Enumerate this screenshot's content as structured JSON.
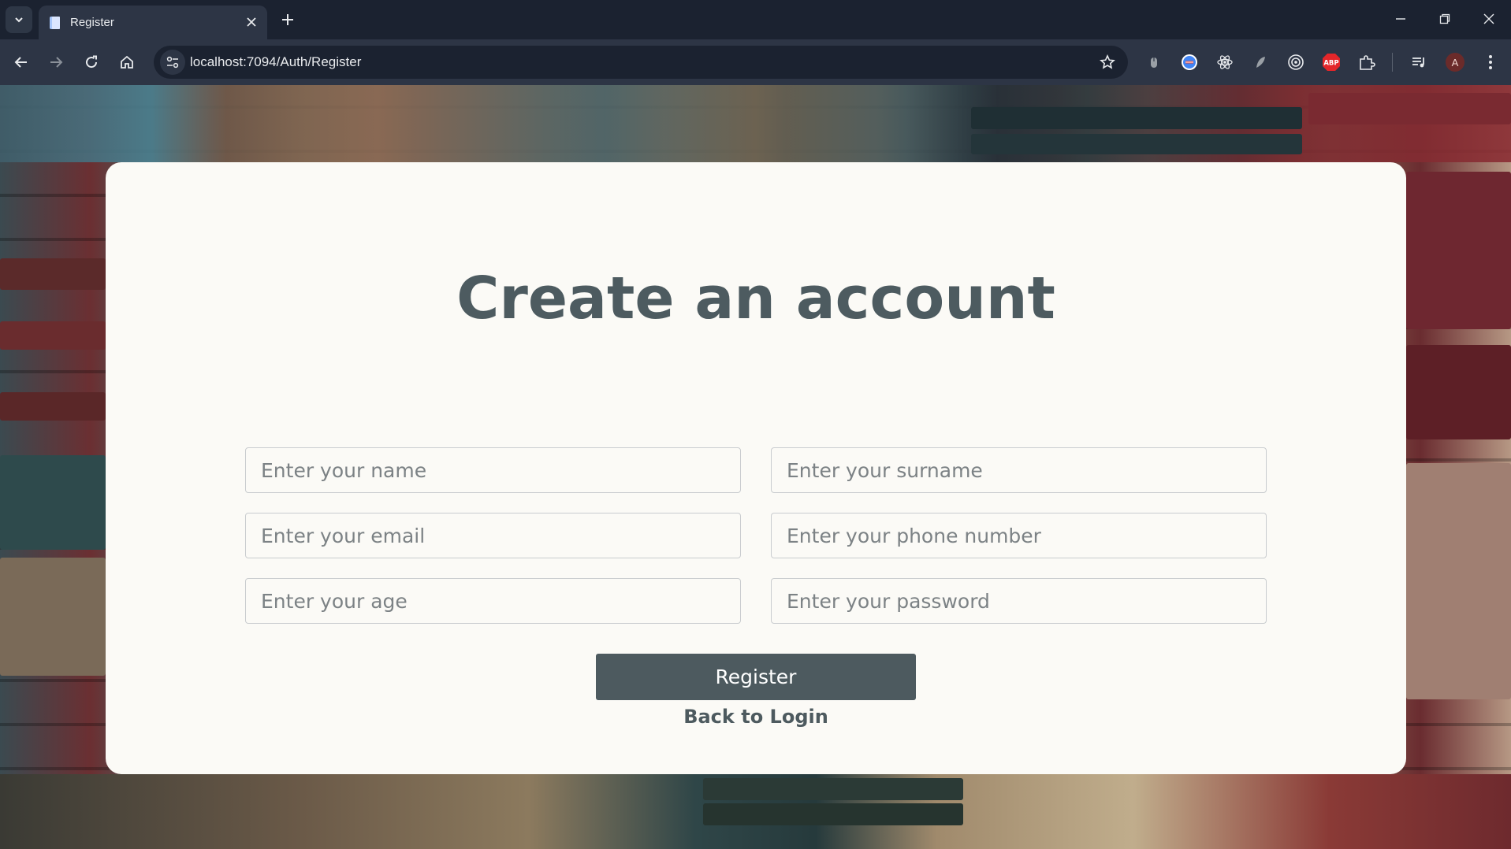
{
  "browser": {
    "tab_title": "Register",
    "url": "localhost:7094/Auth/Register",
    "profile_initial": "A",
    "extensions": [
      "mouse-extension-icon",
      "translate-extension-icon",
      "react-devtools-icon",
      "feather-extension-icon",
      "target-extension-icon",
      "adblock-plus-icon",
      "puzzle-extensions-icon"
    ],
    "abp_label": "ABP"
  },
  "page": {
    "title": "Create an account",
    "fields": {
      "name": "Enter your name",
      "surname": "Enter your surname",
      "email": "Enter your email",
      "phone": "Enter your phone number",
      "age": "Enter your age",
      "password": "Enter your password"
    },
    "register_label": "Register",
    "back_label": "Back to Login"
  },
  "colors": {
    "brand": "#4d5a5f",
    "card_bg": "#fbfaf6",
    "chrome_dark": "#1b2230",
    "chrome_toolbar": "#2d3545"
  }
}
